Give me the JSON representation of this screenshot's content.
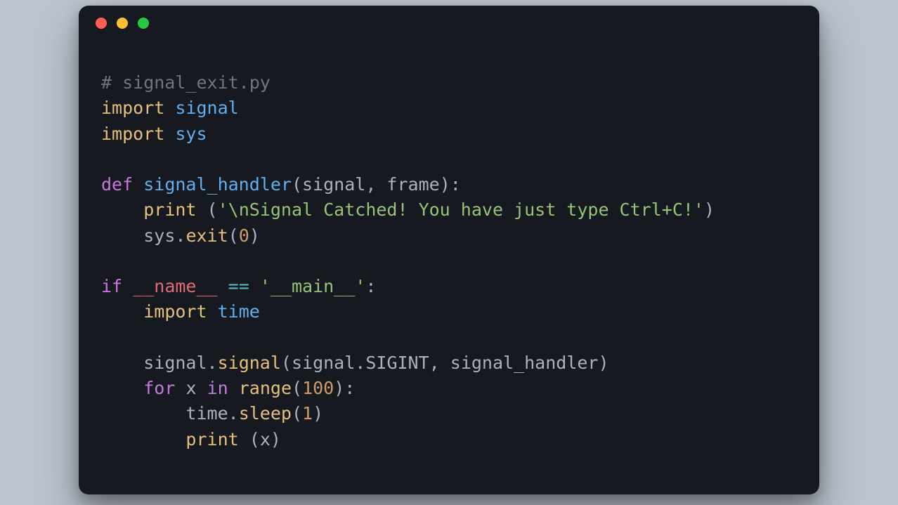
{
  "code": {
    "lines": [
      [
        {
          "cls": "c-comment",
          "t": "# signal_exit.py"
        }
      ],
      [
        {
          "cls": "c-imp",
          "t": "import"
        },
        {
          "cls": "",
          "t": " "
        },
        {
          "cls": "c-mod",
          "t": "signal"
        }
      ],
      [
        {
          "cls": "c-imp",
          "t": "import"
        },
        {
          "cls": "",
          "t": " "
        },
        {
          "cls": "c-mod",
          "t": "sys"
        }
      ],
      [],
      [
        {
          "cls": "c-kw",
          "t": "def"
        },
        {
          "cls": "",
          "t": " "
        },
        {
          "cls": "c-mod",
          "t": "signal_handler"
        },
        {
          "cls": "c-punct",
          "t": "("
        },
        {
          "cls": "c-ident",
          "t": "signal"
        },
        {
          "cls": "c-punct",
          "t": ", "
        },
        {
          "cls": "c-ident",
          "t": "frame"
        },
        {
          "cls": "c-punct",
          "t": "):"
        }
      ],
      [
        {
          "cls": "",
          "t": "    "
        },
        {
          "cls": "c-call",
          "t": "print"
        },
        {
          "cls": "",
          "t": " "
        },
        {
          "cls": "c-punct",
          "t": "("
        },
        {
          "cls": "c-str",
          "t": "'\\nSignal Catched! You have just type Ctrl+C!'"
        },
        {
          "cls": "c-punct",
          "t": ")"
        }
      ],
      [
        {
          "cls": "",
          "t": "    "
        },
        {
          "cls": "c-ident",
          "t": "sys"
        },
        {
          "cls": "c-punct",
          "t": "."
        },
        {
          "cls": "c-call",
          "t": "exit"
        },
        {
          "cls": "c-punct",
          "t": "("
        },
        {
          "cls": "c-num",
          "t": "0"
        },
        {
          "cls": "c-punct",
          "t": ")"
        }
      ],
      [],
      [
        {
          "cls": "c-kw",
          "t": "if"
        },
        {
          "cls": "",
          "t": " "
        },
        {
          "cls": "c-builtin",
          "t": "__name__"
        },
        {
          "cls": "",
          "t": " "
        },
        {
          "cls": "c-op",
          "t": "=="
        },
        {
          "cls": "",
          "t": " "
        },
        {
          "cls": "c-str",
          "t": "'__main__'"
        },
        {
          "cls": "c-punct",
          "t": ":"
        }
      ],
      [
        {
          "cls": "",
          "t": "    "
        },
        {
          "cls": "c-imp",
          "t": "import"
        },
        {
          "cls": "",
          "t": " "
        },
        {
          "cls": "c-mod",
          "t": "time"
        }
      ],
      [],
      [
        {
          "cls": "",
          "t": "    "
        },
        {
          "cls": "c-ident",
          "t": "signal"
        },
        {
          "cls": "c-punct",
          "t": "."
        },
        {
          "cls": "c-call",
          "t": "signal"
        },
        {
          "cls": "c-punct",
          "t": "("
        },
        {
          "cls": "c-ident",
          "t": "signal"
        },
        {
          "cls": "c-punct",
          "t": "."
        },
        {
          "cls": "c-ident",
          "t": "SIGINT"
        },
        {
          "cls": "c-punct",
          "t": ", "
        },
        {
          "cls": "c-ident",
          "t": "signal_handler"
        },
        {
          "cls": "c-punct",
          "t": ")"
        }
      ],
      [
        {
          "cls": "",
          "t": "    "
        },
        {
          "cls": "c-kw",
          "t": "for"
        },
        {
          "cls": "",
          "t": " "
        },
        {
          "cls": "c-ident",
          "t": "x"
        },
        {
          "cls": "",
          "t": " "
        },
        {
          "cls": "c-kw",
          "t": "in"
        },
        {
          "cls": "",
          "t": " "
        },
        {
          "cls": "c-call",
          "t": "range"
        },
        {
          "cls": "c-punct",
          "t": "("
        },
        {
          "cls": "c-num",
          "t": "100"
        },
        {
          "cls": "c-punct",
          "t": "):"
        }
      ],
      [
        {
          "cls": "",
          "t": "        "
        },
        {
          "cls": "c-ident",
          "t": "time"
        },
        {
          "cls": "c-punct",
          "t": "."
        },
        {
          "cls": "c-call",
          "t": "sleep"
        },
        {
          "cls": "c-punct",
          "t": "("
        },
        {
          "cls": "c-num",
          "t": "1"
        },
        {
          "cls": "c-punct",
          "t": ")"
        }
      ],
      [
        {
          "cls": "",
          "t": "        "
        },
        {
          "cls": "c-call",
          "t": "print"
        },
        {
          "cls": "",
          "t": " "
        },
        {
          "cls": "c-punct",
          "t": "("
        },
        {
          "cls": "c-ident",
          "t": "x"
        },
        {
          "cls": "c-punct",
          "t": ")"
        }
      ]
    ]
  }
}
